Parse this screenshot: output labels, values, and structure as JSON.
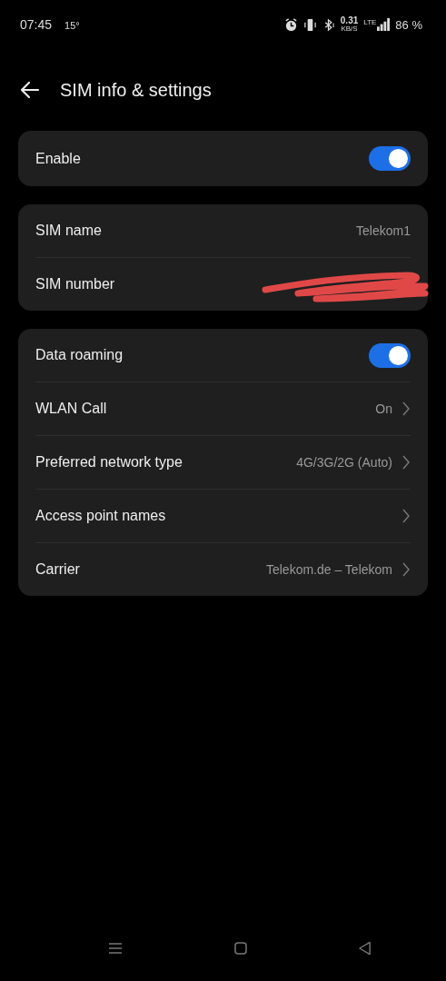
{
  "status_bar": {
    "time": "07:45",
    "temperature": "15°",
    "net_speed": "0.31",
    "net_speed_unit": "KB/S",
    "network_type": "LTE",
    "battery": "86 %"
  },
  "header": {
    "title": "SIM info & settings"
  },
  "groups": [
    {
      "rows": [
        {
          "kind": "toggle",
          "label": "Enable",
          "on": true
        }
      ]
    },
    {
      "rows": [
        {
          "kind": "value",
          "label": "SIM name",
          "value": "Telekom1"
        },
        {
          "kind": "redacted",
          "label": "SIM number"
        }
      ]
    },
    {
      "rows": [
        {
          "kind": "toggle",
          "label": "Data roaming",
          "on": true
        },
        {
          "kind": "link",
          "label": "WLAN Call",
          "value": "On"
        },
        {
          "kind": "link",
          "label": "Preferred network type",
          "value": "4G/3G/2G (Auto)"
        },
        {
          "kind": "link",
          "label": "Access point names"
        },
        {
          "kind": "link",
          "label": "Carrier",
          "value": "Telekom.de – Telekom"
        }
      ]
    }
  ]
}
